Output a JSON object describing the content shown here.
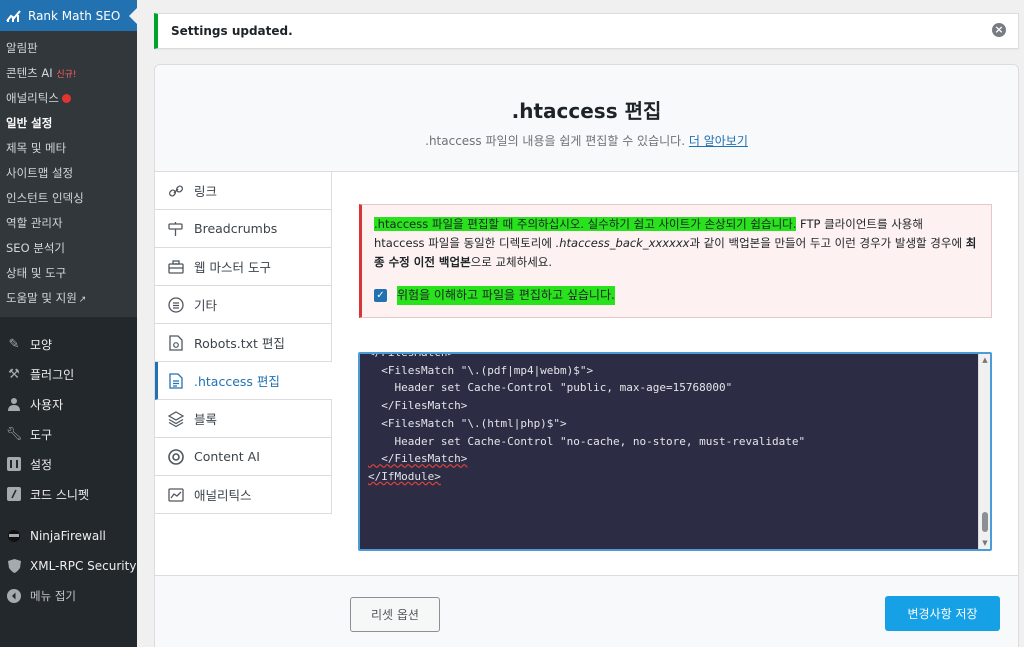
{
  "sidebar": {
    "active_plugin": "Rank Math SEO",
    "submenu": [
      {
        "label": "알림판"
      },
      {
        "label": "콘텐츠 AI",
        "tag": "신규!"
      },
      {
        "label": "애널리틱스"
      },
      {
        "label": "일반 설정"
      },
      {
        "label": "제목 및 메타"
      },
      {
        "label": "사이트맵 설정"
      },
      {
        "label": "인스턴트 인덱싱"
      },
      {
        "label": "역할 관리자"
      },
      {
        "label": "SEO 분석기"
      },
      {
        "label": "상태 및 도구"
      },
      {
        "label": "도움말 및 지원"
      }
    ],
    "menu": [
      {
        "label": "모양",
        "icon": "paintbrush-icon"
      },
      {
        "label": "플러그인",
        "icon": "plugin-icon"
      },
      {
        "label": "사용자",
        "icon": "user-icon"
      },
      {
        "label": "도구",
        "icon": "wrench-icon"
      },
      {
        "label": "설정",
        "icon": "settings-icon"
      },
      {
        "label": "코드 스니펫",
        "icon": "code-icon"
      },
      {
        "label": "NinjaFirewall",
        "icon": "ninja-icon"
      },
      {
        "label": "XML-RPC Security",
        "icon": "shield-icon"
      },
      {
        "label": "메뉴 접기",
        "icon": "collapse-icon"
      }
    ]
  },
  "notice": {
    "text": "Settings updated."
  },
  "header": {
    "title": ".htaccess 편집",
    "description": ".htaccess 파일의 내용을 쉽게 편집할 수 있습니다.",
    "link": "더 알아보기"
  },
  "tabs": [
    {
      "label": "링크",
      "icon": "link-icon"
    },
    {
      "label": "Breadcrumbs",
      "icon": "signpost-icon"
    },
    {
      "label": "웹 마스터 도구",
      "icon": "toolbox-icon"
    },
    {
      "label": "기타",
      "icon": "list-icon"
    },
    {
      "label": "Robots.txt 편집",
      "icon": "robot-file-icon"
    },
    {
      "label": ".htaccess 편집",
      "icon": "document-icon",
      "active": true
    },
    {
      "label": "블록",
      "icon": "blocks-icon"
    },
    {
      "label": "Content AI",
      "icon": "content-ai-icon"
    },
    {
      "label": "애널리틱스",
      "icon": "analytics-icon"
    }
  ],
  "warning": {
    "highlight": ".htaccess 파일을 편집할 때 주의하십시오. 실수하기 쉽고 사이트가 손상되기 쉽습니다.",
    "text1": " FTP 클라이언트를 사용해 htaccess 파일을 동일한 디렉토리에 ",
    "filename": ".htaccess_back_xxxxxx",
    "text2": "과 같이 백업본을 만들어 두고 이런 경우가 발생할 경우에 ",
    "bold": "최종 수정 이전 백업본",
    "text3": "으로 교체하세요.",
    "confirm_label": "위험을 이해하고 파일을 편집하고 싶습니다."
  },
  "editor": {
    "lines": [
      "</FilesMatch>",
      "",
      "  <FilesMatch \"\\.(pdf|mp4|webm)$\">",
      "    Header set Cache-Control \"public, max-age=15768000\"",
      "  </FilesMatch>",
      "",
      "  <FilesMatch \"\\.(html|php)$\">",
      "    Header set Cache-Control \"no-cache, no-store, must-revalidate\"",
      "  </FilesMatch>",
      "</IfModule>"
    ]
  },
  "footer": {
    "reset_label": "리셋 옵션",
    "save_label": "변경사항 저장"
  },
  "colors": {
    "accent": "#2271b1",
    "save": "#16a1e7",
    "highlight": "#28e21c",
    "sidebar": "#23282d"
  }
}
